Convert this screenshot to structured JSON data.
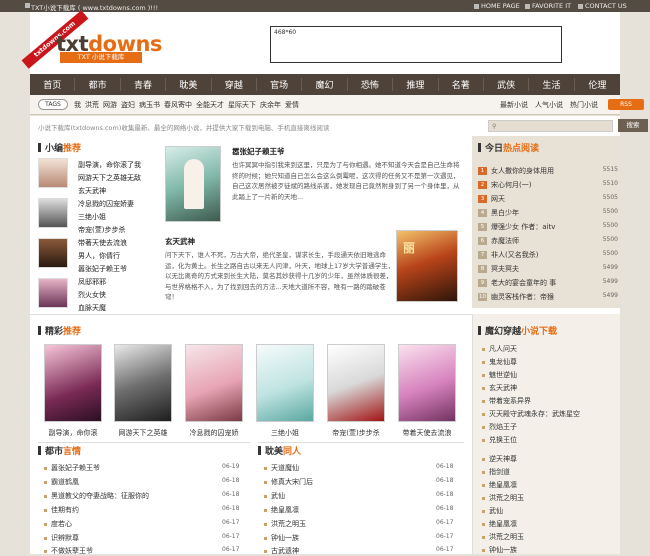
{
  "topbar": {
    "title": "TXT小说下载库 ( www.txtdowns.com )!!!",
    "links": [
      "HOME PAGE",
      "FAVORITE IT",
      "CONTACT US"
    ]
  },
  "header": {
    "logo_a": "txt",
    "logo_b": "downs",
    "logo_sub": "TXT 小说下载库",
    "ribbon": "txtdowns.com",
    "ad_size": "468*60"
  },
  "nav": [
    "首页",
    "都市",
    "青春",
    "耽美",
    "穿越",
    "官场",
    "魔幻",
    "恐怖",
    "推理",
    "名著",
    "武侠",
    "生活",
    "伦理"
  ],
  "tagsbar": {
    "button": "TAGS",
    "tags": [
      "我",
      "洪荒",
      "网游",
      "盗妇",
      "病玉书",
      "春风寄中",
      "全能天才",
      "星际天下",
      "庆余年",
      "爱情"
    ],
    "links": [
      "最新小说",
      "人气小说",
      "热门小说"
    ],
    "rss": "RSS"
  },
  "notice": {
    "text": "小说下载库(txtdowns.com)收集最新、最全的网络小说，并提供大家下载到电脑、手机直接离线阅读",
    "search_button": "搜索"
  },
  "editor": {
    "title_a": "小编",
    "title_b": "推荐",
    "items": [
      "副导演，命你滚了我",
      "网游天下之英雄无敌",
      "玄天武神",
      "冷息戮的囚宠娇妻",
      "三绝小姐",
      "帝宠(萱)步步杀",
      "带著天使去流浪",
      "男人，你倩行",
      "嚣张妃子赖王爷",
      "凤邸邪邪",
      "烈火女侠",
      "血脉天魔"
    ],
    "feature1": {
      "title": "嚣张妃子赖王爷",
      "desc": "也许冥冥中指引我来到这里，只是为了与你相遇。她不知道今天会是自己生命将终的时候；她只知道自己怎么会这么倒霉呢，这次得的任务又不是第一次遇见，自己这次居然被歹徒斌的路线杀害，她发现自己竟然附身到了另一个身体里，从此踏上了一片新的天地..."
    },
    "feature2": {
      "title": "玄天武神",
      "desc": "问下天下，谁人不死，万古大帝，绝代圣皇，谋求长生，手段通天依旧难逃命运，化为黄土。长生之路自古以来无人问津，叶天，地球上17岁大学普通学生，以无比离奇的方式来到长生大陆，莫名其妙获得十几岁的少年，虽然体质很差，与世界格格不入，为了找到回去的方法...天地大道所不容，唯有一路的踏破苍穹！"
    }
  },
  "hot": {
    "title_a": "今日",
    "title_b": "热点阅读",
    "items": [
      {
        "t": "女人撒你的身体用用",
        "n": "5515"
      },
      {
        "t": "宋心何月(一)",
        "n": "5510"
      },
      {
        "t": "网天",
        "n": "5505"
      },
      {
        "t": "黑白少年",
        "n": "5500"
      },
      {
        "t": "爆强少女 作者：aitv",
        "n": "5500"
      },
      {
        "t": "赤魔法师",
        "n": "5500"
      },
      {
        "t": "非人(又名我杀)",
        "n": "5500"
      },
      {
        "t": "冥夫冥夫",
        "n": "5499"
      },
      {
        "t": "老大的宴会童年的 事",
        "n": "5499"
      },
      {
        "t": "幽灵客栈作者：帝猴",
        "n": "5499"
      }
    ]
  },
  "picks": {
    "title_a": "精彩",
    "title_b": "推荐",
    "books": [
      "副导演，命你滚",
      "网游天下之英雄",
      "冷息戮的囚宠娇",
      "三绝小姐",
      "帝宠(萱)步步杀",
      "带着天使去流浪"
    ]
  },
  "fantasy": {
    "title_a": "魔幻穿越",
    "title_b": "小说下载",
    "items": [
      "凡人问天",
      "鬼龙仙尊",
      "魅世逆仙",
      "玄天武神",
      "带着宠系异界",
      "灭天殿守武魂永存：武炼星空",
      "烈焰王子",
      "兑换王位"
    ],
    "items2": [
      "逆天神尊",
      "指剑道",
      "绝皇凰凛",
      "洪荒之明玉",
      "武仙",
      "绝皇凰凛",
      "洪荒之明玉",
      "钟仙一族"
    ]
  },
  "city": {
    "title_a": "都市",
    "title_b": "言情",
    "items": [
      {
        "t": "嚣张妃子赖王爷",
        "d": "06-19"
      },
      {
        "t": "霸道鹤凰",
        "d": "06-18"
      },
      {
        "t": "黑道教父的夺妻战略：征服你的",
        "d": "06-18"
      },
      {
        "t": "佳期有约",
        "d": "06-18"
      },
      {
        "t": "度若心",
        "d": "06-17"
      },
      {
        "t": "识辨默尊",
        "d": "06-17"
      },
      {
        "t": "不做妖孽王爷",
        "d": "06-17"
      }
    ]
  },
  "bl": {
    "title_a": "耽美",
    "title_b": "同人",
    "items": [
      {
        "t": "天道魔仙",
        "d": "06-18"
      },
      {
        "t": "修真大宋门后",
        "d": "06-18"
      },
      {
        "t": "武仙",
        "d": "06-18"
      },
      {
        "t": "绝皇凰凛",
        "d": "06-18"
      },
      {
        "t": "洪荒之明玉",
        "d": "06-17"
      },
      {
        "t": "钟仙一族",
        "d": "06-17"
      },
      {
        "t": "古武遗神",
        "d": "06-17"
      }
    ]
  },
  "colors": {
    "accent": "#e66d14",
    "nav_bg": "#4f4339",
    "ribbon": "#c9151b"
  }
}
